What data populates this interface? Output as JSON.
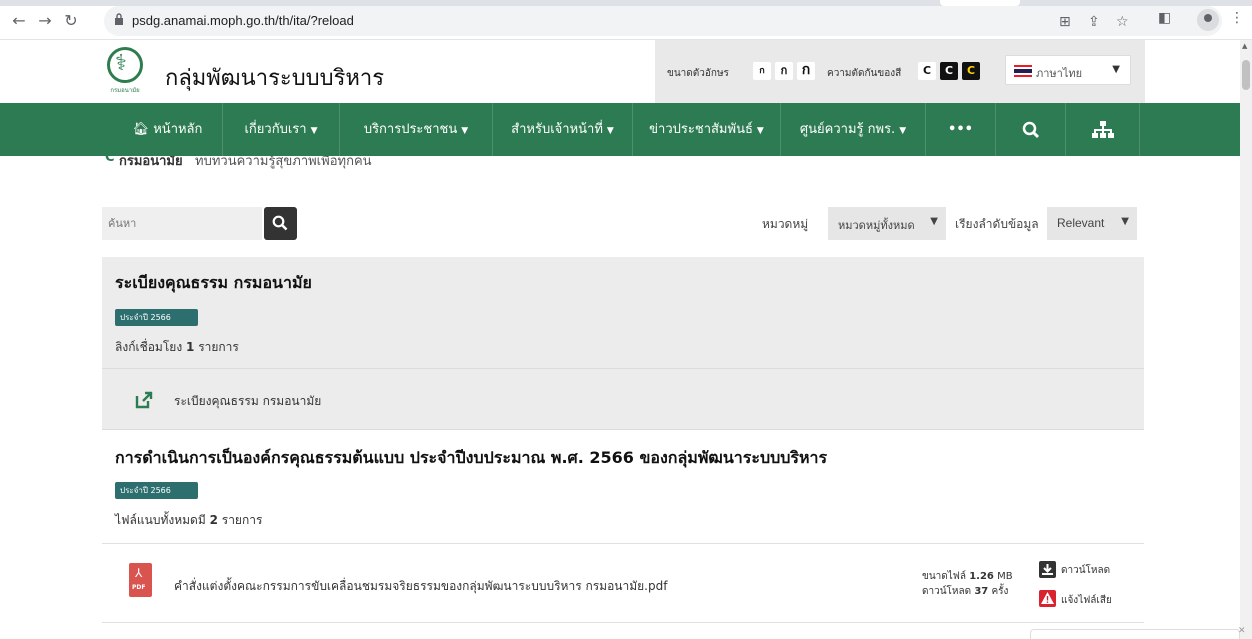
{
  "browser": {
    "url": "psdg.anamai.moph.go.th/th/ita/?reload"
  },
  "header": {
    "logo_subtext": "กรมอนามัย",
    "site_title": "กลุ่มพัฒนาระบบบริหาร",
    "font_size_label": "ขนาดตัวอักษร",
    "font_size_options": [
      "ก",
      "ก",
      "ก"
    ],
    "contrast_label": "ความตัดกันของสี",
    "contrast_options": [
      "C",
      "C",
      "C"
    ],
    "language": "ภาษาไทย"
  },
  "nav": {
    "items": [
      {
        "label": "หน้าหลัก",
        "icon": "home-icon"
      },
      {
        "label": "เกี่ยวกับเรา"
      },
      {
        "label": "บริการประชาชน"
      },
      {
        "label": "สำหรับเจ้าหน้าที่"
      },
      {
        "label": "ข่าวประชาสัมพันธ์"
      },
      {
        "label": "ศูนย์ความรู้ กพร."
      },
      {
        "label": "•••"
      }
    ]
  },
  "breadcrumb": {
    "org": "กรมอนามัย",
    "slogan": "ทบทวนความรู้สุขภาพเพื่อทุกคน"
  },
  "search": {
    "placeholder": "ค้นหา",
    "category_label": "หมวดหมู่",
    "category_value": "หมวดหมู่ทั้งหมด",
    "sort_label": "เรียงลำดับข้อมูล",
    "sort_value": "Relevant"
  },
  "items": [
    {
      "title": "ระเบียงคุณธรรม กรมอนามัย",
      "badge": "ประจำปี 2566",
      "count_prefix": "ลิงก์เชื่อมโยง",
      "count": "1",
      "count_suffix": "รายการ",
      "link_text": "ระเบียงคุณธรรม กรมอนามัย"
    },
    {
      "title": "การดำเนินการเป็นองค์กรคุณธรรมต้นแบบ ประจำปีงบประมาณ พ.ศ. 2566 ของกลุ่มพัฒนาระบบบริหาร",
      "badge": "ประจำปี 2566",
      "count_prefix": "ไฟล์แนบทั้งหมดมี",
      "count": "2",
      "count_suffix": "รายการ",
      "file": {
        "name": "คำสั่งแต่งตั้งคณะกรรมการขับเคลื่อนชมรมจริยธรรมของกลุ่มพัฒนาระบบบริหาร กรมอนามัย.pdf",
        "size_label": "ขนาดไฟล์",
        "size": "1.26",
        "size_unit": "MB",
        "downloads_label": "ดาวน์โหลด",
        "downloads": "37",
        "downloads_unit": "ครั้ง",
        "download_action": "ดาวน์โหลด",
        "report_action": "แจ้งไฟล์เสีย",
        "type_label": "PDF"
      }
    }
  ],
  "colors": {
    "primary_green": "#2d7b52",
    "badge_teal": "#2d6e6e",
    "pdf_red": "#d9534f"
  }
}
